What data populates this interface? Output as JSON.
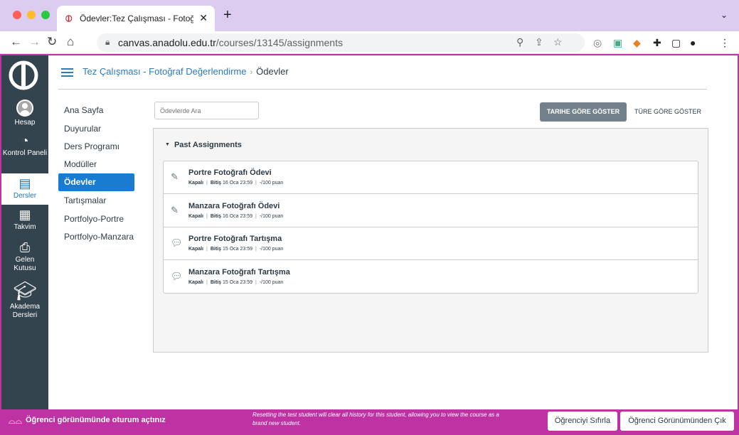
{
  "browser": {
    "tab_title": "Ödevler:Tez Çalışması - Fotoğr",
    "url_host": "canvas.anadolu.edu.tr",
    "url_path": "/courses/13145/assignments"
  },
  "global_nav": {
    "items": [
      {
        "label": "Hesap",
        "icon": "user-avatar-icon"
      },
      {
        "label": "Kontrol Paneli",
        "icon": "dashboard-icon"
      },
      {
        "label": "Dersler",
        "icon": "courses-icon"
      },
      {
        "label": "Takvim",
        "icon": "calendar-icon"
      },
      {
        "label": "Gelen Kutusu",
        "icon": "inbox-icon"
      },
      {
        "label": "Akadema Dersleri",
        "icon": "graduation-cap-icon"
      }
    ]
  },
  "breadcrumb": {
    "course": "Tez Çalışması - Fotoğraf Değerlendirme",
    "separator": "›",
    "current": "Ödevler"
  },
  "course_nav": {
    "items": [
      "Ana Sayfa",
      "Duyurular",
      "Ders Programı",
      "Modüller",
      "Ödevler",
      "Tartışmalar",
      "Portfolyo-Portre",
      "Portfolyo-Manzara"
    ]
  },
  "search": {
    "placeholder": "Ödevlerde Ara"
  },
  "view_buttons": {
    "by_date": "TARIHE GÖRE GÖSTER",
    "by_type": "TÜRE GÖRE GÖSTER"
  },
  "group": {
    "title": "Past Assignments",
    "items": [
      {
        "title": "Portre Fotoğrafı Ödevi",
        "status": "Kapalı",
        "due_label": "Bitiş",
        "due": "16 Oca 23:59",
        "points": "-/100 puan",
        "icon": "assignment-icon"
      },
      {
        "title": "Manzara Fotoğrafı Ödevi",
        "status": "Kapalı",
        "due_label": "Bitiş",
        "due": "16 Oca 23:59",
        "points": "-/100 puan",
        "icon": "assignment-icon"
      },
      {
        "title": "Portre Fotoğrafı Tartışma",
        "status": "Kapalı",
        "due_label": "Bitiş",
        "due": "15 Oca 23:59",
        "points": "-/100 puan",
        "icon": "discussion-icon"
      },
      {
        "title": "Manzara Fotoğrafı Tartışma",
        "status": "Kapalı",
        "due_label": "Bitiş",
        "due": "15 Oca 23:59",
        "points": "-/100 puan",
        "icon": "discussion-icon"
      }
    ]
  },
  "student_view": {
    "label": "Öğrenci görünümünde oturum açtınız",
    "message": "Resetting the test student will clear all history for this student, allowing you to view the course as a brand new student.",
    "reset_button": "Öğrenciyi Sıfırla",
    "leave_button": "Öğrenci Görünümünden Çık"
  },
  "colors": {
    "accent": "#1a7cd1",
    "student_view_bar": "#bf32a4",
    "global_nav": "#34444f"
  }
}
